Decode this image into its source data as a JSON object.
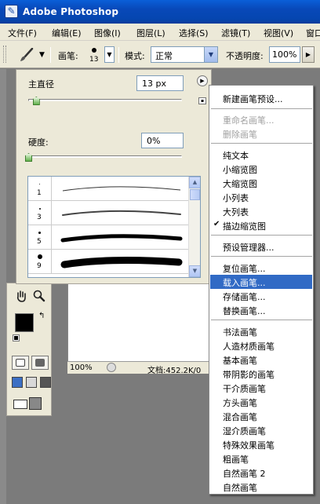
{
  "app": {
    "title": "Adobe Photoshop"
  },
  "menubar": {
    "items": [
      "文件(F)",
      "编辑(E)",
      "图像(I)",
      "图层(L)",
      "选择(S)",
      "滤镜(T)",
      "视图(V)",
      "窗口"
    ]
  },
  "options": {
    "brush_label": "画笔:",
    "brush_size": "13",
    "mode_label": "模式:",
    "mode_value": "正常",
    "opacity_label": "不透明度:",
    "opacity_value": "100%"
  },
  "brush_panel": {
    "master_diameter_label": "主直径",
    "master_diameter_value": "13 px",
    "master_diameter_fraction": 0.05,
    "hardness_label": "硬度:",
    "hardness_value": "0%",
    "hardness_fraction": 0.0,
    "presets": [
      {
        "size_label": "1"
      },
      {
        "size_label": "3"
      },
      {
        "size_label": "5"
      },
      {
        "size_label": "9"
      }
    ]
  },
  "canvas": {
    "zoom": "100%",
    "doc_info": "文档:452.2K/0"
  },
  "menu": {
    "items": [
      {
        "label": "新建画笔预设...",
        "state": "normal"
      },
      {
        "label": "重命名画笔...",
        "state": "disabled"
      },
      {
        "label": "删除画笔",
        "state": "disabled"
      },
      {
        "label": "纯文本",
        "state": "normal"
      },
      {
        "label": "小缩览图",
        "state": "normal"
      },
      {
        "label": "大缩览图",
        "state": "normal"
      },
      {
        "label": "小列表",
        "state": "normal"
      },
      {
        "label": "大列表",
        "state": "normal"
      },
      {
        "label": "描边缩览图",
        "state": "checked"
      },
      {
        "label": "预设管理器...",
        "state": "normal"
      },
      {
        "label": "复位画笔...",
        "state": "normal"
      },
      {
        "label": "载入画笔...",
        "state": "highlighted"
      },
      {
        "label": "存储画笔...",
        "state": "normal"
      },
      {
        "label": "替换画笔...",
        "state": "normal"
      },
      {
        "label": "书法画笔",
        "state": "normal"
      },
      {
        "label": "人造材质画笔",
        "state": "normal"
      },
      {
        "label": "基本画笔",
        "state": "normal"
      },
      {
        "label": "带阴影的画笔",
        "state": "normal"
      },
      {
        "label": "干介质画笔",
        "state": "normal"
      },
      {
        "label": "方头画笔",
        "state": "normal"
      },
      {
        "label": "混合画笔",
        "state": "normal"
      },
      {
        "label": "湿介质画笔",
        "state": "normal"
      },
      {
        "label": "特殊效果画笔",
        "state": "normal"
      },
      {
        "label": "粗画笔",
        "state": "normal"
      },
      {
        "label": "自然画笔 2",
        "state": "normal"
      },
      {
        "label": "自然画笔",
        "state": "normal"
      }
    ]
  },
  "colors": {
    "titlebar": "#0848b8",
    "highlight": "#316ac5",
    "chrome": "#ece9d8"
  }
}
